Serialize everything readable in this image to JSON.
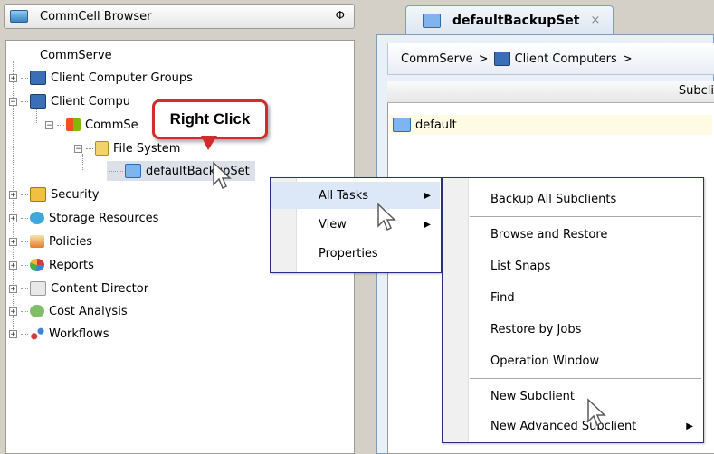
{
  "left_panel": {
    "title": "CommCell Browser",
    "pin_glyph": "Ф",
    "tree": {
      "root": "CommServe",
      "client_computer_groups": "Client Computer Groups",
      "client_computers": "Client Compu",
      "commserve_node": "CommSe",
      "file_system": "File System",
      "default_backup_set": "defaultBackupSet",
      "security": "Security",
      "storage_resources": "Storage Resources",
      "policies": "Policies",
      "reports": "Reports",
      "content_director": "Content Director",
      "cost_analysis": "Cost Analysis",
      "workflows": "Workflows"
    }
  },
  "callout": {
    "text": "Right Click"
  },
  "tab": {
    "title": "defaultBackupSet",
    "close": "×"
  },
  "breadcrumb": {
    "part1": "CommServe",
    "sep": ">",
    "part2": "Client Computers",
    "sep2": ">"
  },
  "grid": {
    "header": "Subcli",
    "row": "default"
  },
  "context_menu": {
    "items": [
      {
        "label": "All Tasks",
        "has_submenu": true
      },
      {
        "label": "View",
        "has_submenu": true
      },
      {
        "label": "Properties",
        "has_submenu": false
      }
    ]
  },
  "submenu": {
    "items": [
      {
        "label": "Backup All Subclients"
      },
      {
        "label": "Browse and Restore"
      },
      {
        "label": "List Snaps"
      },
      {
        "label": "Find"
      },
      {
        "label": "Restore by Jobs"
      },
      {
        "label": "Operation Window"
      },
      {
        "label": "New Subclient"
      },
      {
        "label": "New Advanced Subclient",
        "has_submenu": true
      }
    ]
  },
  "colors": {
    "callout_border": "#d22b2b",
    "menu_border": "#2a2f86",
    "highlight": "#dce7f7"
  }
}
